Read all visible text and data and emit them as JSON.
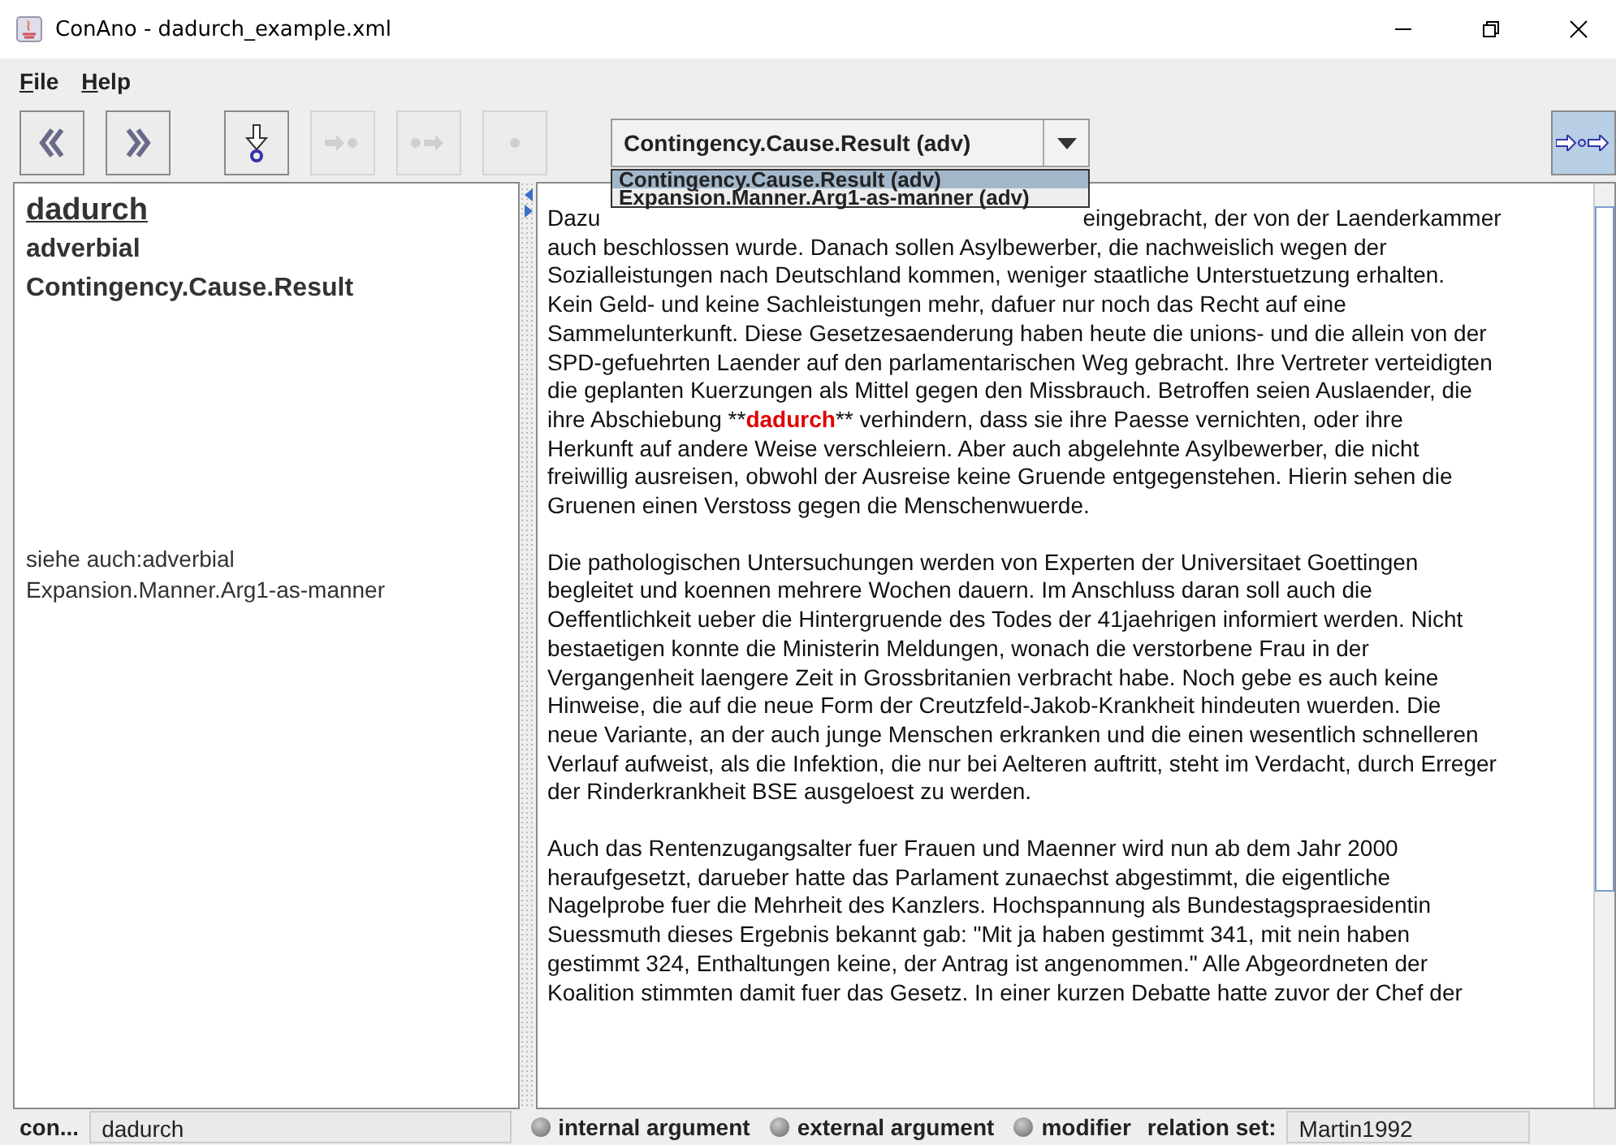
{
  "window": {
    "title": "ConAno - dadurch_example.xml"
  },
  "menu": [
    {
      "label": "File"
    },
    {
      "label": "Help"
    }
  ],
  "toolbar": {
    "buttons": [
      {
        "kind": "previous",
        "disabled": false
      },
      {
        "kind": "next",
        "disabled": false
      },
      {
        "kind": "down",
        "disabled": false
      },
      {
        "kind": "arrow-dot",
        "disabled": true
      },
      {
        "kind": "dot-arrow",
        "disabled": true
      },
      {
        "kind": "dot",
        "disabled": true
      }
    ],
    "combo": {
      "value": "Contingency.Cause.Result (adv)",
      "options": [
        {
          "label": "Contingency.Cause.Result (adv)",
          "selected": true
        },
        {
          "label": "Expansion.Manner.Arg1-as-manner (adv)",
          "selected": false
        }
      ]
    },
    "right_button": {
      "kind": "arrow-dot-arrow",
      "disabled": false
    }
  },
  "info": {
    "word": "dadurch",
    "category": "adverbial",
    "relation": "Contingency.Cause.Result",
    "see_also": [
      "siehe auch:adverbial",
      "Expansion.Manner.Arg1-as-manner"
    ]
  },
  "text": {
    "paragraphs": [
      {
        "lines": [
          [
            "Dazu",
            "eingebracht, der von der Laenderkammer"
          ],
          "auch beschlossen wurde. Danach sollen Asylbewerber, die nachweislich wegen der",
          "Sozialleistungen nach Deutschland kommen, weniger staatliche Unterstuetzung erhalten.",
          "Kein Geld- und keine Sachleistungen mehr, dafuer nur noch das Recht auf eine",
          "Sammelunterkunft. Diese Gesetzesaenderung haben heute die unions- und die allein von der",
          "SPD-gefuehrten Laender auf den parlamentarischen Weg gebracht. Ihre Vertreter verteidigten",
          "die geplanten Kuerzungen als Mittel gegen den Missbrauch. Betroffen seien Auslaender, die",
          {
            "before": "ihre Abschiebung **",
            "highlight": "dadurch",
            "after": "** verhindern, dass sie ihre Paesse vernichten, oder ihre"
          },
          "Herkunft auf andere Weise verschleiern. Aber auch abgelehnte Asylbewerber, die nicht",
          "freiwillig ausreisen, obwohl der Ausreise keine Gruende entgegenstehen. Hierin sehen die",
          "Gruenen einen Verstoss gegen die Menschenwuerde."
        ]
      },
      {
        "lines": [
          "Die pathologischen Untersuchungen werden von Experten der Universitaet Goettingen",
          "begleitet und koennen mehrere Wochen dauern. Im Anschluss daran soll auch die",
          "Oeffentlichkeit ueber die Hintergruende des Todes der 41jaehrigen informiert werden. Nicht",
          "bestaetigen konnte die Ministerin Meldungen, wonach die verstorbene Frau in der",
          "Vergangenheit laengere Zeit in Grossbritanien verbracht habe. Noch gebe es auch keine",
          "Hinweise, die auf die neue Form der Creutzfeld-Jakob-Krankheit hindeuten wuerden. Die",
          "neue Variante, an der auch junge Menschen erkranken und die einen wesentlich schnelleren",
          "Verlauf aufweist, als die Infektion, die nur bei Aelteren auftritt, steht im Verdacht, durch Erreger",
          "der Rinderkrankheit BSE ausgeloest zu werden."
        ]
      },
      {
        "lines": [
          "Auch das Rentenzugangsalter fuer Frauen und Maenner wird nun ab dem Jahr 2000",
          "heraufgesetzt, darueber hatte das Parlament zunaechst abgestimmt, die eigentliche",
          "Nagelprobe fuer die Mehrheit des Kanzlers. Hochspannung als Bundestagspraesidentin",
          "Suessmuth dieses Ergebnis bekannt gab: \"Mit ja haben gestimmt 341, mit nein haben",
          "gestimmt 324, Enthaltungen keine, der Antrag ist angenommen.\" Alle Abgeordneten der",
          "Koalition stimmten damit fuer das Gesetz. In einer kurzen Debatte hatte zuvor der Chef der"
        ]
      }
    ]
  },
  "status_bar": {
    "label": "con...",
    "word": "dadurch",
    "roles": [
      {
        "label": "internal argument",
        "selected": false
      },
      {
        "label": "external argument",
        "selected": false
      },
      {
        "label": "modifier",
        "selected": false
      }
    ],
    "relation_label": "relation set:",
    "relation_value": "Martin1992"
  }
}
